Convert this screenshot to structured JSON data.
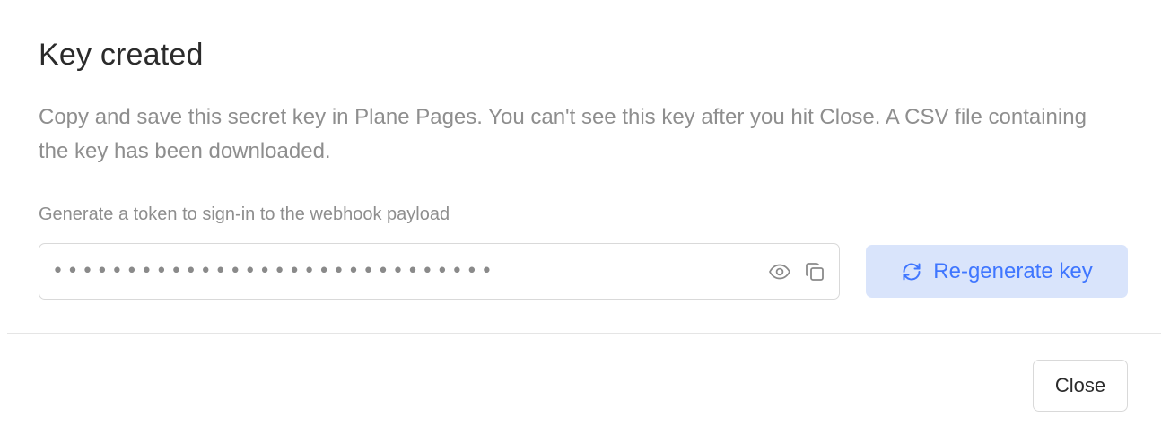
{
  "modal": {
    "title": "Key created",
    "description": "Copy and save this secret key in Plane Pages. You can't see this key after you hit Close. A CSV file containing the key has been downloaded.",
    "field_label": "Generate a token to sign-in to the webhook payload",
    "key_masked": "••••••••••••••••••••••••••••••",
    "icons": {
      "show": "eye-icon",
      "copy": "copy-icon",
      "regenerate": "refresh-icon"
    },
    "regenerate_label": "Re-generate key",
    "close_label": "Close"
  },
  "colors": {
    "accent": "#3f76ff",
    "accent_bg": "#d9e4fb",
    "muted_text": "#8e8e8e",
    "border": "#d9d9d9"
  }
}
